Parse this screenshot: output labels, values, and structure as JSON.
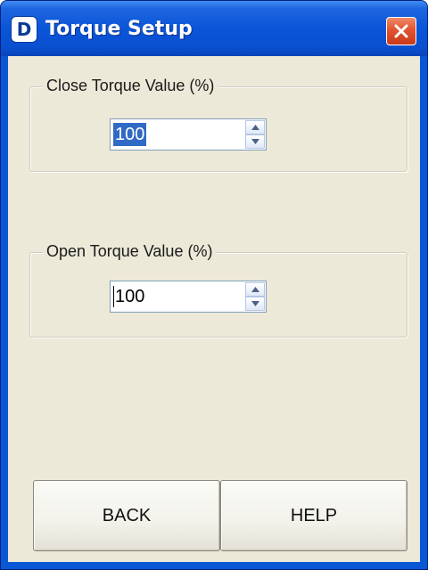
{
  "window": {
    "title": "Torque Setup",
    "app_icon_glyph": "D",
    "icons": {
      "app": "app-d-icon",
      "close": "close-x-icon"
    }
  },
  "close_group": {
    "label": "Close Torque Value (%)",
    "value": "100"
  },
  "open_group": {
    "label": "Open Torque Value (%)",
    "value": "100"
  },
  "buttons": {
    "back": "BACK",
    "help": "HELP"
  },
  "colors": {
    "titlebar": "#0a55d8",
    "client_bg": "#ece9d8",
    "close_button": "#e2532f",
    "selection": "#316ac5"
  }
}
